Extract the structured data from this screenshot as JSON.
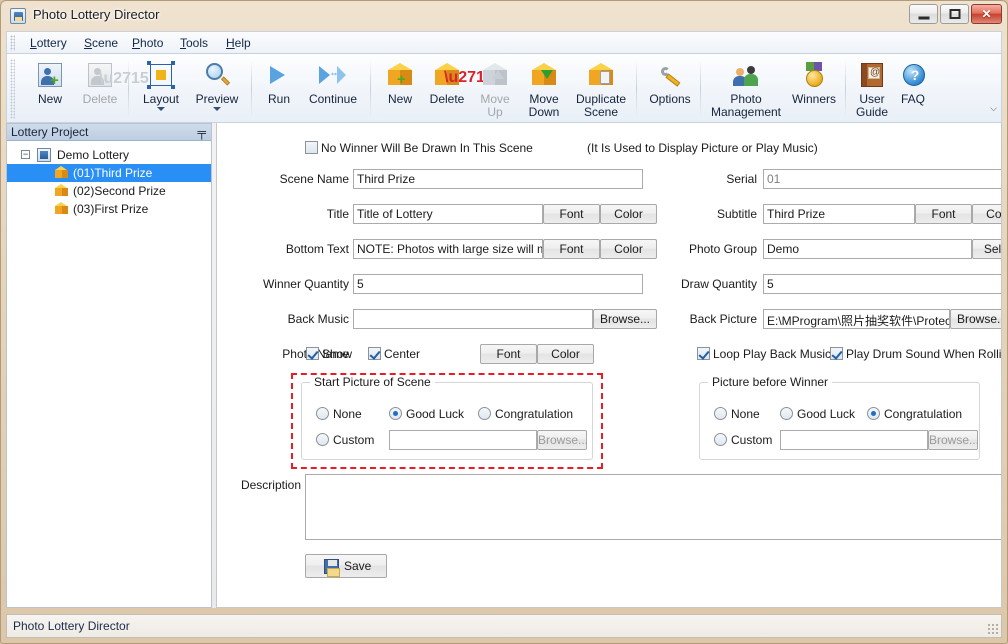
{
  "window": {
    "title": "Photo Lottery Director",
    "controls": {
      "minimize": "–",
      "maximize": "□",
      "close": "✕"
    }
  },
  "menu": {
    "items": [
      {
        "label": "Lottery",
        "mnemonic": "L"
      },
      {
        "label": "Scene",
        "mnemonic": "S"
      },
      {
        "label": "Photo",
        "mnemonic": "P"
      },
      {
        "label": "Tools",
        "mnemonic": "T"
      },
      {
        "label": "Help",
        "mnemonic": "H"
      }
    ]
  },
  "toolbar": {
    "overflow_glyph": "⌵",
    "buttons": [
      {
        "id": "lottery-new",
        "label": "New",
        "icon": "new-photo-icon",
        "enabled": true
      },
      {
        "id": "lottery-delete",
        "label": "Delete",
        "icon": "delete-photo-icon",
        "enabled": false
      },
      {
        "id": "layout",
        "label": "Layout",
        "icon": "layout-icon",
        "enabled": true,
        "dropdown": true
      },
      {
        "id": "preview",
        "label": "Preview",
        "icon": "magnifier-icon",
        "enabled": true,
        "dropdown": true
      },
      {
        "id": "run",
        "label": "Run",
        "icon": "play-icon",
        "enabled": true
      },
      {
        "id": "continue",
        "label": "Continue",
        "icon": "continue-icon",
        "enabled": true
      },
      {
        "id": "scene-new",
        "label": "New",
        "icon": "cube-plus-icon",
        "enabled": true
      },
      {
        "id": "scene-delete",
        "label": "Delete",
        "icon": "cube-cross-icon",
        "enabled": true
      },
      {
        "id": "move-up",
        "label": "Move\nUp",
        "label_line1": "Move",
        "label_line2": "Up",
        "icon": "cube-arrow-up-icon",
        "enabled": false
      },
      {
        "id": "move-down",
        "label_line1": "Move",
        "label_line2": "Down",
        "icon": "cube-arrow-down-icon",
        "enabled": true
      },
      {
        "id": "duplicate-scene",
        "label_line1": "Duplicate",
        "label_line2": "Scene",
        "icon": "cube-copy-icon",
        "enabled": true
      },
      {
        "id": "options",
        "label": "Options",
        "icon": "wrench-icon",
        "enabled": true
      },
      {
        "id": "photo-management",
        "label_line1": "Photo",
        "label_line2": "Management",
        "icon": "people-icon",
        "enabled": true
      },
      {
        "id": "winners",
        "label": "Winners",
        "icon": "medal-icon",
        "enabled": true
      },
      {
        "id": "user-guide",
        "label_line1": "User",
        "label_line2": "Guide",
        "icon": "book-icon",
        "enabled": true
      },
      {
        "id": "faq",
        "label": "FAQ",
        "icon": "help-circle-icon",
        "enabled": true
      }
    ]
  },
  "left_panel": {
    "caption": "Lottery Project",
    "pin_glyph": "╤",
    "tree": {
      "root": {
        "label": "Demo Lottery",
        "expander": "−"
      },
      "children": [
        {
          "label": "(01)Third Prize",
          "selected": true
        },
        {
          "label": "(02)Second Prize",
          "selected": false
        },
        {
          "label": "(03)First Prize",
          "selected": false
        }
      ]
    }
  },
  "form": {
    "no_winner_checkbox": {
      "label": "No Winner Will Be Drawn In This Scene",
      "note": "(It Is Used to Display Picture or Play Music)",
      "checked": false
    },
    "scene_name": {
      "label": "Scene Name",
      "value": "Third Prize"
    },
    "serial": {
      "label": "Serial",
      "value": "01",
      "disabled": true
    },
    "title": {
      "label": "Title",
      "value": "Title of Lottery",
      "font_button": "Font",
      "color_button": "Color"
    },
    "subtitle": {
      "label": "Subtitle",
      "value": "Third Prize",
      "font_button": "Font",
      "color_button": "Color"
    },
    "bottom_text": {
      "label": "Bottom Text",
      "value": "NOTE: Photos with large size will ma",
      "font_button": "Font",
      "color_button": "Color"
    },
    "photo_group": {
      "label": "Photo Group",
      "value": "Demo",
      "select_button": "Select"
    },
    "winner_quantity": {
      "label": "Winner Quantity",
      "value": "5"
    },
    "draw_quantity": {
      "label": "Draw Quantity",
      "value": "5"
    },
    "back_music": {
      "label": "Back Music",
      "value": "",
      "browse_button": "Browse..."
    },
    "back_picture": {
      "label": "Back Picture",
      "value": "E:\\MProgram\\照片抽奖软件\\Protected\\back.jp",
      "browse_button": "Browse..."
    },
    "photo_name": {
      "label": "Photo Name",
      "show": {
        "label": "Show",
        "checked": true
      },
      "center": {
        "label": "Center",
        "checked": true
      },
      "font_button": "Font",
      "color_button": "Color"
    },
    "loop_play_back_music": {
      "label": "Loop Play Back Music",
      "checked": true
    },
    "play_drum_sound": {
      "label": "Play Drum Sound When Rolling P",
      "checked": true
    },
    "start_picture_group": {
      "title": "Start Picture of Scene",
      "highlighted": true,
      "options": [
        {
          "label": "None",
          "selected": false
        },
        {
          "label": "Good Luck",
          "selected": true
        },
        {
          "label": "Congratulation",
          "selected": false
        },
        {
          "label": "Custom",
          "selected": false
        }
      ],
      "custom_path": "",
      "browse_button": "Browse...",
      "browse_disabled": true
    },
    "picture_before_winner_group": {
      "title": "Picture before Winner",
      "highlighted": false,
      "options": [
        {
          "label": "None",
          "selected": false
        },
        {
          "label": "Good Luck",
          "selected": false
        },
        {
          "label": "Congratulation",
          "selected": true
        },
        {
          "label": "Custom",
          "selected": false
        }
      ],
      "custom_path": "",
      "browse_button": "Browse...",
      "browse_disabled": true
    },
    "description": {
      "label": "Description",
      "value": ""
    },
    "save_button": {
      "label": "Save",
      "icon": "floppy-disk-icon"
    }
  },
  "status_bar": {
    "text": "Photo Lottery Director"
  },
  "colors": {
    "highlight_red": "#ec1c24",
    "tree_selection": "#2a8ff5",
    "window_chrome": "#e6d5bd"
  }
}
